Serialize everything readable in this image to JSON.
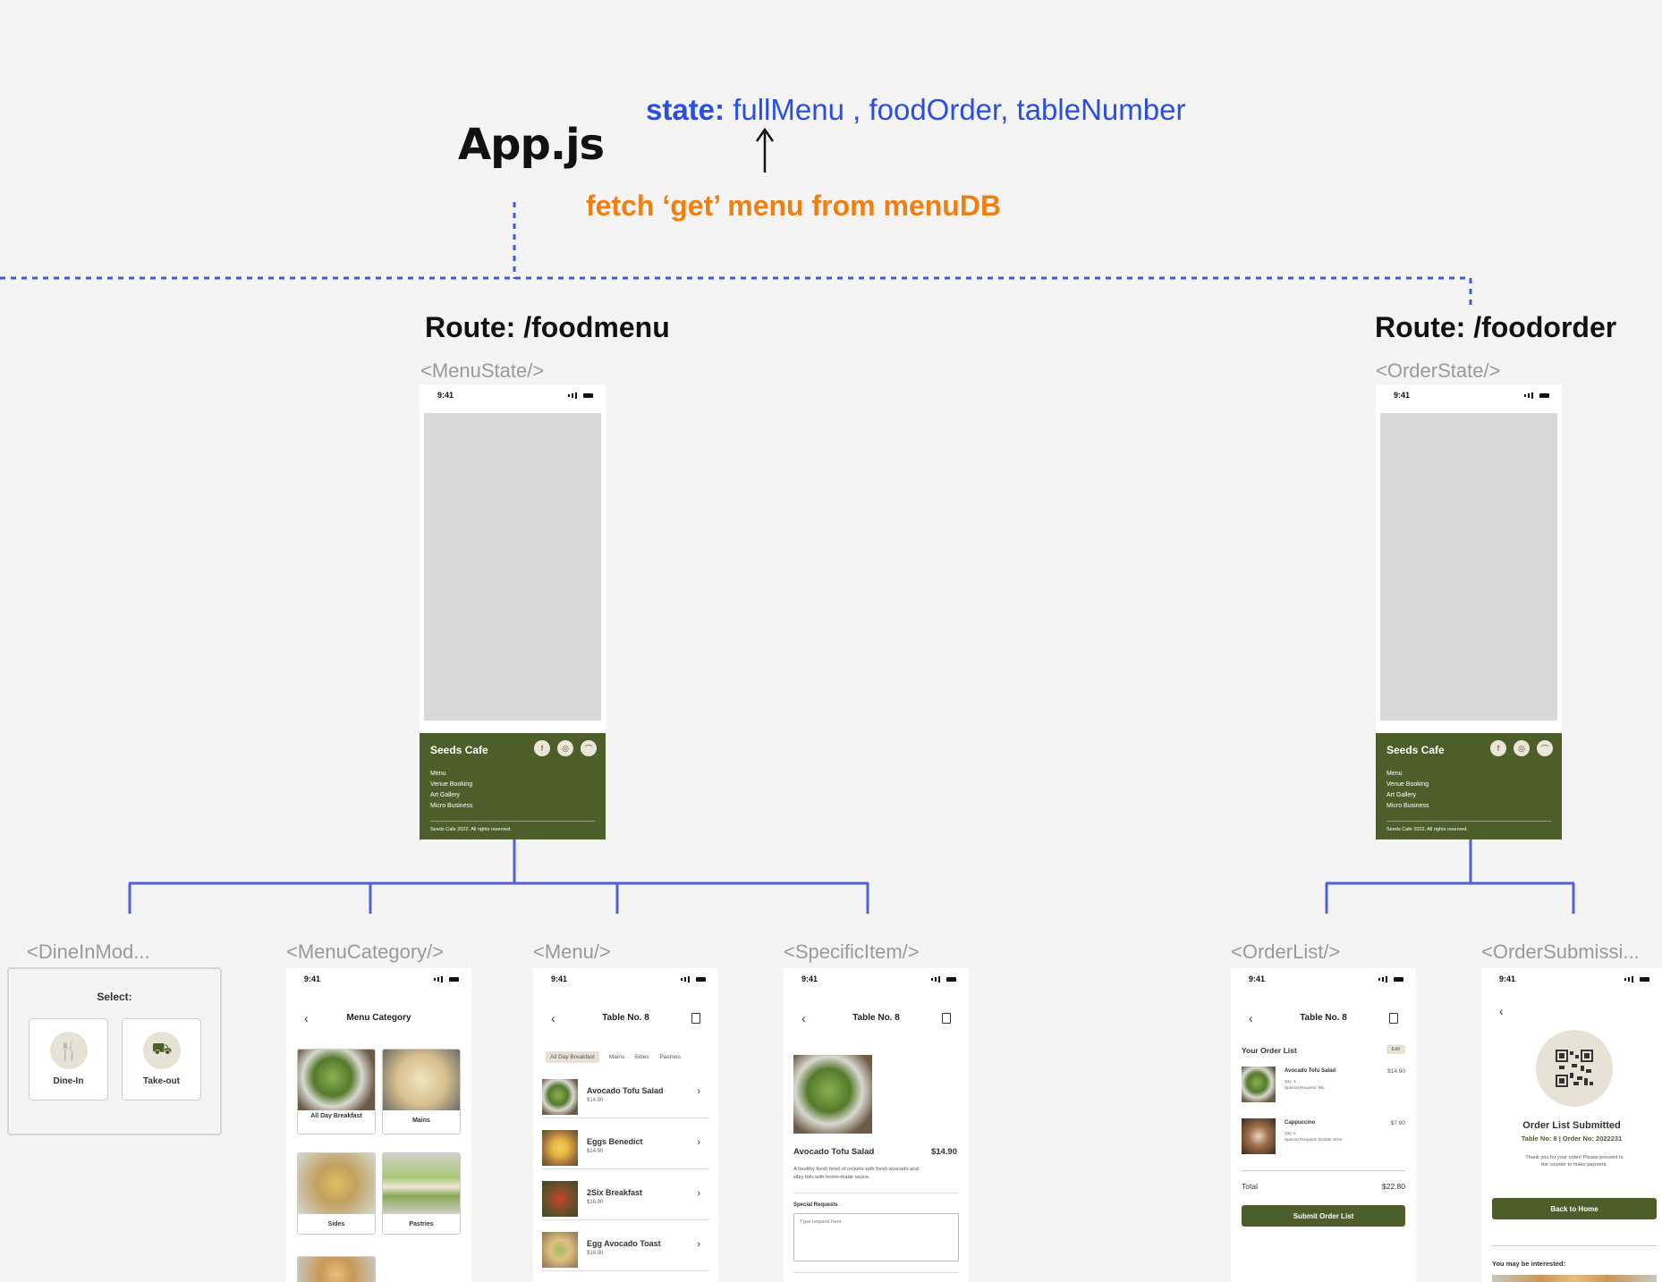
{
  "app": {
    "title": "App.js",
    "state_label": "state:",
    "state_vars": "fullMenu , foodOrder, tableNumber",
    "fetch_note": "fetch ‘get’ menu from menuDB"
  },
  "routes": {
    "foodmenu": {
      "label": "Route: /foodmenu",
      "component": "<MenuState/>"
    },
    "foodorder": {
      "label": "Route: /foodorder",
      "component": "<OrderState/>"
    }
  },
  "phone_common": {
    "time": "9:41",
    "footer": {
      "brand": "Seeds Cafe",
      "links": [
        "Menu",
        "Venue Booking",
        "Art Gallery",
        "Micro Business"
      ],
      "copyright": "Seeds Cafe 2022. All rights reserved."
    }
  },
  "children": {
    "dinein": {
      "component": "<DineInMod...",
      "select": "Select:",
      "options": [
        {
          "label": "Dine-In",
          "icon": "utensils-icon"
        },
        {
          "label": "Take-out",
          "icon": "delivery-icon"
        }
      ]
    },
    "menucategory": {
      "component": "<MenuCategory/>",
      "title": "Menu Category",
      "categories": [
        "All Day Breakfast",
        "Mains",
        "Sides",
        "Pastries"
      ]
    },
    "menu": {
      "component": "<Menu/>",
      "title": "Table No. 8",
      "tabs": [
        "All Day Breakfast",
        "Mains",
        "Sides",
        "Pastries"
      ],
      "items": [
        {
          "name": "Avocado Tofu Salad",
          "price": "$14.90"
        },
        {
          "name": "Eggs Benedict",
          "price": "$14.90"
        },
        {
          "name": "2Six Breakfast",
          "price": "$16.90"
        },
        {
          "name": "Egg Avocado Toast",
          "price": "$16.90"
        }
      ]
    },
    "specificitem": {
      "component": "<SpecificItem/>",
      "title": "Table No. 8",
      "name": "Avocado Tofu Salad",
      "price": "$14.90",
      "description": "A healthy fresh bowl of rockets with fresh avocado and silky tofu with home-made sauce.",
      "special_label": "Special Requests",
      "special_placeholder": "Type request here"
    },
    "orderlist": {
      "component": "<OrderList/>",
      "title": "Table No. 8",
      "heading": "Your Order List",
      "edit": "Edit",
      "items": [
        {
          "name": "Avocado Tofu Salad",
          "price": "$14.90",
          "qty": "Qty: 1",
          "request": "Special Request: NIL"
        },
        {
          "name": "Cappuccino",
          "price": "$7.90",
          "qty": "Qty: 1",
          "request": "Special Request: Double Shot"
        }
      ],
      "total_label": "Total",
      "total_value": "$22.80",
      "submit": "Submit Order List"
    },
    "ordersubmission": {
      "component": "<OrderSubmissi...",
      "heading": "Order List Submitted",
      "table": "Table No: 8",
      "order": "| Order No: 2022231",
      "message": "Thank you for your order! Please proceed to the counter to make payment.",
      "home_button": "Back to Home",
      "interested": "You may be interested:"
    }
  }
}
